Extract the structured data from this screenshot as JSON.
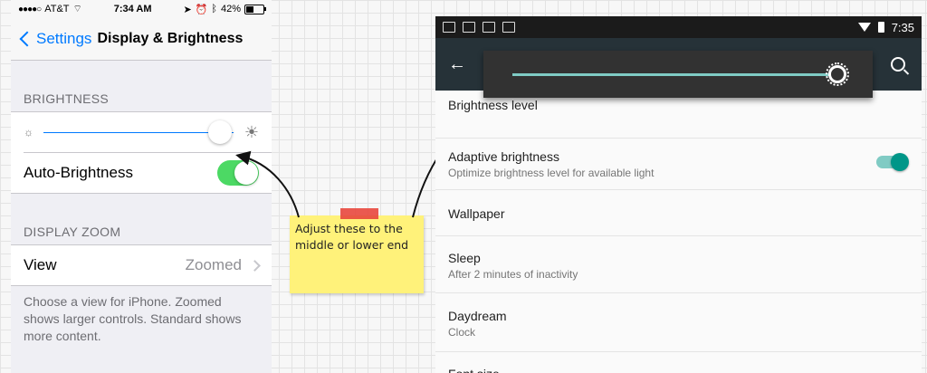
{
  "ios": {
    "status": {
      "signal": "●●●●○",
      "carrier": "AT&T",
      "time": "7:34 AM",
      "battery": "42%"
    },
    "nav": {
      "back_label": "Settings",
      "title": "Display & Brightness"
    },
    "brightness_header": "BRIGHTNESS",
    "brightness_level": 0.93,
    "auto_brightness_label": "Auto-Brightness",
    "auto_brightness_on": true,
    "zoom_header": "DISPLAY ZOOM",
    "view_label": "View",
    "view_value": "Zoomed",
    "footer": "Choose a view for iPhone. Zoomed shows larger controls. Standard shows more content."
  },
  "note": {
    "text": "Adjust these to the middle or lower end"
  },
  "android": {
    "status": {
      "time": "7:35"
    },
    "brightness_level": 0.98,
    "items": [
      {
        "title": "Brightness level",
        "subtitle": ""
      },
      {
        "title": "Adaptive brightness",
        "subtitle": "Optimize brightness level for available light",
        "toggle": true
      },
      {
        "title": "Wallpaper",
        "subtitle": ""
      },
      {
        "title": "Sleep",
        "subtitle": "After 2 minutes of inactivity"
      },
      {
        "title": "Daydream",
        "subtitle": "Clock"
      },
      {
        "title": "Font size",
        "subtitle": ""
      }
    ],
    "accent_color": "#009688"
  }
}
